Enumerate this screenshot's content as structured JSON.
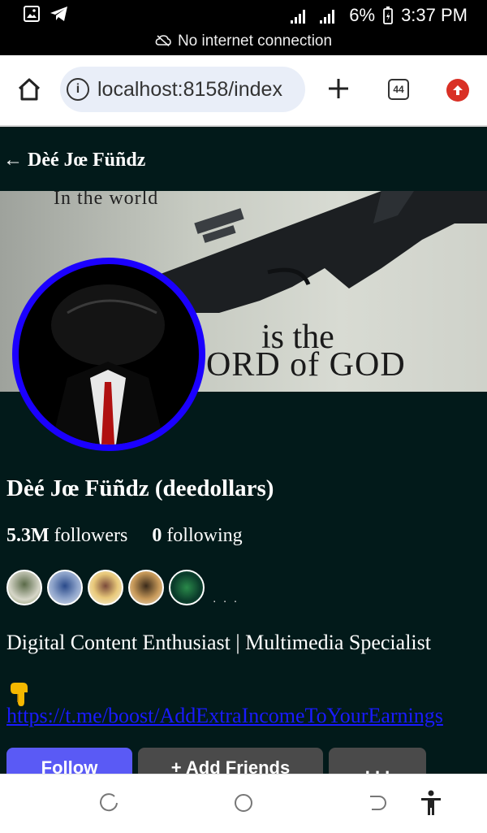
{
  "status_bar": {
    "battery": "6%",
    "time": "3:37 PM",
    "network_message": "No internet connection",
    "icons": [
      "gallery-icon",
      "telegram-icon",
      "signal-icon",
      "signal-icon",
      "battery-icon",
      "cloud-off-icon"
    ]
  },
  "browser": {
    "url": "localhost:8158/index",
    "tab_count": "44",
    "icons": [
      "home-icon",
      "info-icon",
      "plus-icon",
      "tabs-icon",
      "update-icon"
    ]
  },
  "header": {
    "back_label": "← Dèé Jœ Füñdz"
  },
  "cover": {
    "top_text": "In the world",
    "line1": "is the",
    "line2": "ORD of GOD"
  },
  "profile": {
    "name": "Dèé Jœ Füñdz (deedollars)",
    "followers_count": "5.3M",
    "followers_label": "followers",
    "following_count": "0",
    "following_label": "following",
    "more_friends": ". . .",
    "bio": "Digital Content Enthusiast | Multimedia Specialist",
    "emoji": "👇",
    "link": "https://t.me/boost/AddExtraIncomeToYourEarnings"
  },
  "actions": {
    "follow": "Follow",
    "add_friends": "+ Add Friends",
    "more": ". . ."
  },
  "colors": {
    "page_bg": "#021a1a",
    "avatar_ring": "#1b00ff",
    "follow_button": "#5a5af5",
    "secondary_button": "#4a4a4a",
    "link": "#1a1aff"
  },
  "nav_bar": {
    "icons": [
      "recent-apps-icon",
      "home-circle-icon",
      "back-icon",
      "accessibility-icon"
    ]
  }
}
